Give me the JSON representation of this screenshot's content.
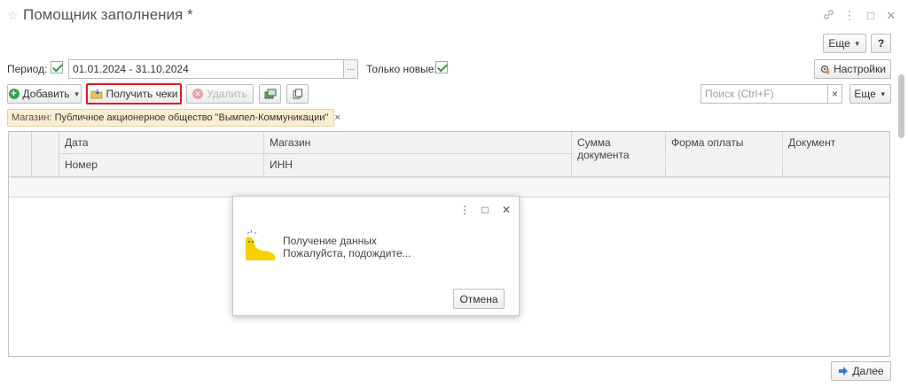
{
  "window": {
    "title": "Помощник заполнения *",
    "star_icon": "star-icon",
    "controls": [
      "link-icon",
      "more-vertical-icon",
      "maximize-icon",
      "close-icon"
    ]
  },
  "header_buttons": {
    "more_label": "Еще",
    "help_label": "?"
  },
  "period": {
    "label": "Период:",
    "checked": true,
    "value": "01.01.2024 - 31.10.2024",
    "picker_label": "..."
  },
  "only_new": {
    "label": "Только новые:",
    "checked": true
  },
  "settings_label": "Настройки",
  "toolbar": {
    "add_label": "Добавить",
    "get_receipts_label": "Получить чеки",
    "delete_label": "Удалить",
    "more_label": "Еще"
  },
  "search": {
    "placeholder": "Поиск (Ctrl+F)",
    "clear_label": "×"
  },
  "filter": {
    "key": "Магазин:",
    "value": "Публичное акционерное общество \"Вымпел-Коммуникации\"",
    "close_label": "×"
  },
  "table": {
    "columns": {
      "date": "Дата",
      "number": "Номер",
      "store": "Магазин",
      "inn": "ИНН",
      "sum": "Сумма документа",
      "payment": "Форма оплаты",
      "document": "Документ"
    }
  },
  "modal": {
    "line1": "Получение данных",
    "line2": "Пожалуйста, подождите...",
    "cancel_label": "Отмена"
  },
  "footer": {
    "next_label": "Далее"
  },
  "colors": {
    "highlight_border": "#e01b22",
    "check_green": "#2e9b3a",
    "filter_bg": "#fbeed0",
    "mascot_yellow": "#f5d000"
  }
}
